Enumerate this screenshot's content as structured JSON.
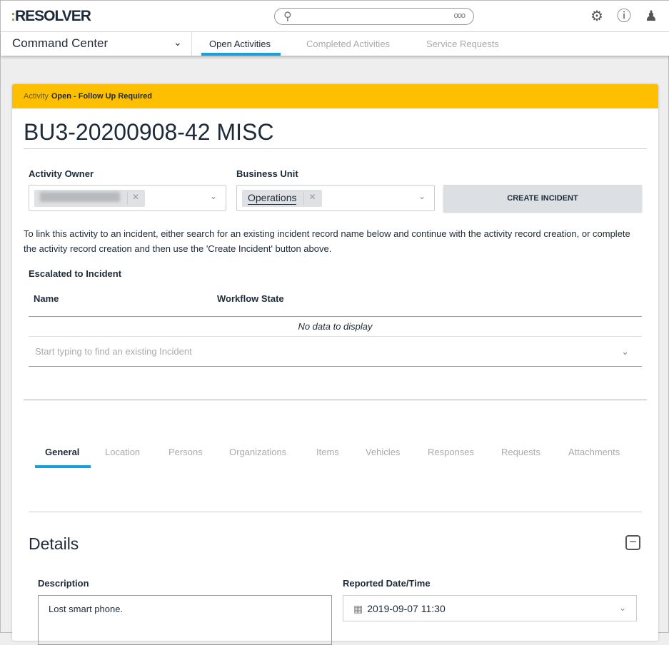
{
  "header": {
    "logo": "RESOLVER",
    "search_placeholder": ""
  },
  "nav": {
    "app": "Command Center",
    "tabs": [
      "Open Activities",
      "Completed Activities",
      "Service Requests"
    ]
  },
  "status": {
    "label": "Activity",
    "value": "Open - Follow Up Required"
  },
  "record": {
    "title": "BU3-20200908-42 MISC"
  },
  "fields": {
    "owner_label": "Activity Owner",
    "bu_label": "Business Unit",
    "bu_value": "Operations",
    "create_button": "CREATE INCIDENT"
  },
  "help_text": "To link this activity to an incident, either search for an existing incident record name below and continue with the activity record creation, or complete the activity record creation and then use the 'Create Incident' button above.",
  "escalated": {
    "label": "Escalated to Incident",
    "columns": [
      "Name",
      "Workflow State"
    ],
    "empty": "No data to display",
    "placeholder": "Start typing to find an existing Incident"
  },
  "tabs": [
    "General",
    "Location",
    "Persons",
    "Organizations",
    "Items",
    "Vehicles",
    "Responses",
    "Requests",
    "Attachments"
  ],
  "details": {
    "title": "Details",
    "description_label": "Description",
    "description_value": "Lost smart phone.",
    "date_label": "Reported Date/Time",
    "date_value": "2019-09-07 11:30"
  }
}
